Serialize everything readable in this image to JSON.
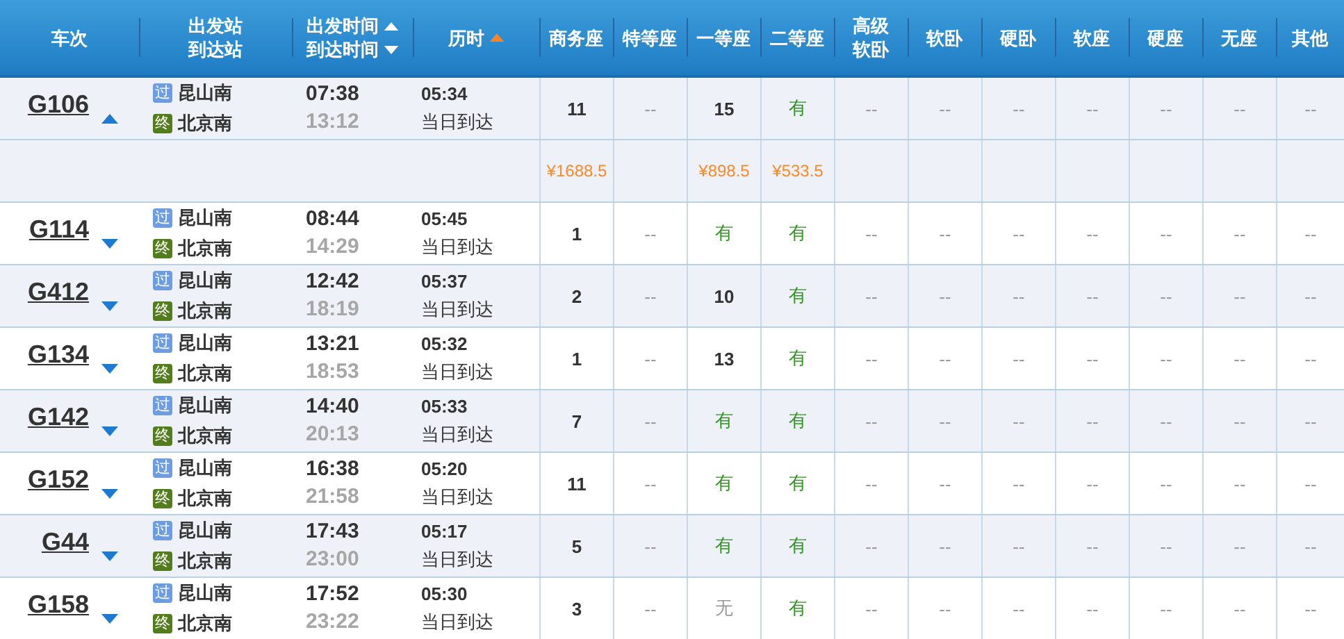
{
  "columns": [
    {
      "lines": [
        {
          "text": "车次"
        }
      ]
    },
    {
      "lines": [
        {
          "text": "出发站"
        },
        {
          "text": "到达站"
        }
      ]
    },
    {
      "lines": [
        {
          "text": "出发时间",
          "ascending": true,
          "active": false
        },
        {
          "text": "到达时间",
          "ascending": false,
          "active": false
        }
      ]
    },
    {
      "lines": [
        {
          "text": "历时",
          "ascending": true,
          "active": true
        }
      ]
    },
    {
      "lines": [
        {
          "text": "商务座"
        }
      ]
    },
    {
      "lines": [
        {
          "text": "特等座"
        }
      ]
    },
    {
      "lines": [
        {
          "text": "一等座"
        }
      ]
    },
    {
      "lines": [
        {
          "text": "二等座"
        }
      ]
    },
    {
      "lines": [
        {
          "text": "高级"
        },
        {
          "text": "软卧"
        }
      ]
    },
    {
      "lines": [
        {
          "text": "软卧"
        }
      ]
    },
    {
      "lines": [
        {
          "text": "硬卧"
        }
      ]
    },
    {
      "lines": [
        {
          "text": "软座"
        }
      ]
    },
    {
      "lines": [
        {
          "text": "硬座"
        }
      ]
    },
    {
      "lines": [
        {
          "text": "无座"
        }
      ]
    },
    {
      "lines": [
        {
          "text": "其他"
        }
      ]
    }
  ],
  "trains": [
    {
      "number": "G106",
      "expanded": true,
      "from": {
        "badge": "过",
        "kind": "pass",
        "name": "昆山南"
      },
      "to": {
        "badge": "终",
        "kind": "terminal",
        "name": "北京南"
      },
      "depart": "07:38",
      "arrive": "13:12",
      "duration": "05:34",
      "arrival_day": "当日到达",
      "seats": [
        {
          "text": "11",
          "kind": "count",
          "price": "¥1688.5"
        },
        {
          "text": "--",
          "kind": "dash"
        },
        {
          "text": "15",
          "kind": "count",
          "price": "¥898.5"
        },
        {
          "text": "有",
          "kind": "available",
          "price": "¥533.5"
        },
        {
          "text": "--",
          "kind": "dash"
        },
        {
          "text": "--",
          "kind": "dash"
        },
        {
          "text": "--",
          "kind": "dash"
        },
        {
          "text": "--",
          "kind": "dash"
        },
        {
          "text": "--",
          "kind": "dash"
        },
        {
          "text": "--",
          "kind": "dash"
        },
        {
          "text": "--",
          "kind": "dash"
        }
      ]
    },
    {
      "number": "G114",
      "expanded": false,
      "from": {
        "badge": "过",
        "kind": "pass",
        "name": "昆山南"
      },
      "to": {
        "badge": "终",
        "kind": "terminal",
        "name": "北京南"
      },
      "depart": "08:44",
      "arrive": "14:29",
      "duration": "05:45",
      "arrival_day": "当日到达",
      "seats": [
        {
          "text": "1",
          "kind": "count"
        },
        {
          "text": "--",
          "kind": "dash"
        },
        {
          "text": "有",
          "kind": "available"
        },
        {
          "text": "有",
          "kind": "available"
        },
        {
          "text": "--",
          "kind": "dash"
        },
        {
          "text": "--",
          "kind": "dash"
        },
        {
          "text": "--",
          "kind": "dash"
        },
        {
          "text": "--",
          "kind": "dash"
        },
        {
          "text": "--",
          "kind": "dash"
        },
        {
          "text": "--",
          "kind": "dash"
        },
        {
          "text": "--",
          "kind": "dash"
        }
      ]
    },
    {
      "number": "G412",
      "expanded": false,
      "from": {
        "badge": "过",
        "kind": "pass",
        "name": "昆山南"
      },
      "to": {
        "badge": "终",
        "kind": "terminal",
        "name": "北京南"
      },
      "depart": "12:42",
      "arrive": "18:19",
      "duration": "05:37",
      "arrival_day": "当日到达",
      "seats": [
        {
          "text": "2",
          "kind": "count"
        },
        {
          "text": "--",
          "kind": "dash"
        },
        {
          "text": "10",
          "kind": "count"
        },
        {
          "text": "有",
          "kind": "available"
        },
        {
          "text": "--",
          "kind": "dash"
        },
        {
          "text": "--",
          "kind": "dash"
        },
        {
          "text": "--",
          "kind": "dash"
        },
        {
          "text": "--",
          "kind": "dash"
        },
        {
          "text": "--",
          "kind": "dash"
        },
        {
          "text": "--",
          "kind": "dash"
        },
        {
          "text": "--",
          "kind": "dash"
        }
      ]
    },
    {
      "number": "G134",
      "expanded": false,
      "from": {
        "badge": "过",
        "kind": "pass",
        "name": "昆山南"
      },
      "to": {
        "badge": "终",
        "kind": "terminal",
        "name": "北京南"
      },
      "depart": "13:21",
      "arrive": "18:53",
      "duration": "05:32",
      "arrival_day": "当日到达",
      "seats": [
        {
          "text": "1",
          "kind": "count"
        },
        {
          "text": "--",
          "kind": "dash"
        },
        {
          "text": "13",
          "kind": "count"
        },
        {
          "text": "有",
          "kind": "available"
        },
        {
          "text": "--",
          "kind": "dash"
        },
        {
          "text": "--",
          "kind": "dash"
        },
        {
          "text": "--",
          "kind": "dash"
        },
        {
          "text": "--",
          "kind": "dash"
        },
        {
          "text": "--",
          "kind": "dash"
        },
        {
          "text": "--",
          "kind": "dash"
        },
        {
          "text": "--",
          "kind": "dash"
        }
      ]
    },
    {
      "number": "G142",
      "expanded": false,
      "from": {
        "badge": "过",
        "kind": "pass",
        "name": "昆山南"
      },
      "to": {
        "badge": "终",
        "kind": "terminal",
        "name": "北京南"
      },
      "depart": "14:40",
      "arrive": "20:13",
      "duration": "05:33",
      "arrival_day": "当日到达",
      "seats": [
        {
          "text": "7",
          "kind": "count"
        },
        {
          "text": "--",
          "kind": "dash"
        },
        {
          "text": "有",
          "kind": "available"
        },
        {
          "text": "有",
          "kind": "available"
        },
        {
          "text": "--",
          "kind": "dash"
        },
        {
          "text": "--",
          "kind": "dash"
        },
        {
          "text": "--",
          "kind": "dash"
        },
        {
          "text": "--",
          "kind": "dash"
        },
        {
          "text": "--",
          "kind": "dash"
        },
        {
          "text": "--",
          "kind": "dash"
        },
        {
          "text": "--",
          "kind": "dash"
        }
      ]
    },
    {
      "number": "G152",
      "expanded": false,
      "from": {
        "badge": "过",
        "kind": "pass",
        "name": "昆山南"
      },
      "to": {
        "badge": "终",
        "kind": "terminal",
        "name": "北京南"
      },
      "depart": "16:38",
      "arrive": "21:58",
      "duration": "05:20",
      "arrival_day": "当日到达",
      "seats": [
        {
          "text": "11",
          "kind": "count"
        },
        {
          "text": "--",
          "kind": "dash"
        },
        {
          "text": "有",
          "kind": "available"
        },
        {
          "text": "有",
          "kind": "available"
        },
        {
          "text": "--",
          "kind": "dash"
        },
        {
          "text": "--",
          "kind": "dash"
        },
        {
          "text": "--",
          "kind": "dash"
        },
        {
          "text": "--",
          "kind": "dash"
        },
        {
          "text": "--",
          "kind": "dash"
        },
        {
          "text": "--",
          "kind": "dash"
        },
        {
          "text": "--",
          "kind": "dash"
        }
      ]
    },
    {
      "number": "G44",
      "expanded": false,
      "from": {
        "badge": "过",
        "kind": "pass",
        "name": "昆山南"
      },
      "to": {
        "badge": "终",
        "kind": "terminal",
        "name": "北京南"
      },
      "depart": "17:43",
      "arrive": "23:00",
      "duration": "05:17",
      "arrival_day": "当日到达",
      "seats": [
        {
          "text": "5",
          "kind": "count"
        },
        {
          "text": "--",
          "kind": "dash"
        },
        {
          "text": "有",
          "kind": "available"
        },
        {
          "text": "有",
          "kind": "available"
        },
        {
          "text": "--",
          "kind": "dash"
        },
        {
          "text": "--",
          "kind": "dash"
        },
        {
          "text": "--",
          "kind": "dash"
        },
        {
          "text": "--",
          "kind": "dash"
        },
        {
          "text": "--",
          "kind": "dash"
        },
        {
          "text": "--",
          "kind": "dash"
        },
        {
          "text": "--",
          "kind": "dash"
        }
      ]
    },
    {
      "number": "G158",
      "expanded": false,
      "from": {
        "badge": "过",
        "kind": "pass",
        "name": "昆山南"
      },
      "to": {
        "badge": "终",
        "kind": "terminal",
        "name": "北京南"
      },
      "depart": "17:52",
      "arrive": "23:22",
      "duration": "05:30",
      "arrival_day": "当日到达",
      "seats": [
        {
          "text": "3",
          "kind": "count"
        },
        {
          "text": "--",
          "kind": "dash"
        },
        {
          "text": "无",
          "kind": "none"
        },
        {
          "text": "有",
          "kind": "available"
        },
        {
          "text": "--",
          "kind": "dash"
        },
        {
          "text": "--",
          "kind": "dash"
        },
        {
          "text": "--",
          "kind": "dash"
        },
        {
          "text": "--",
          "kind": "dash"
        },
        {
          "text": "--",
          "kind": "dash"
        },
        {
          "text": "--",
          "kind": "dash"
        },
        {
          "text": "--",
          "kind": "dash"
        }
      ]
    }
  ]
}
